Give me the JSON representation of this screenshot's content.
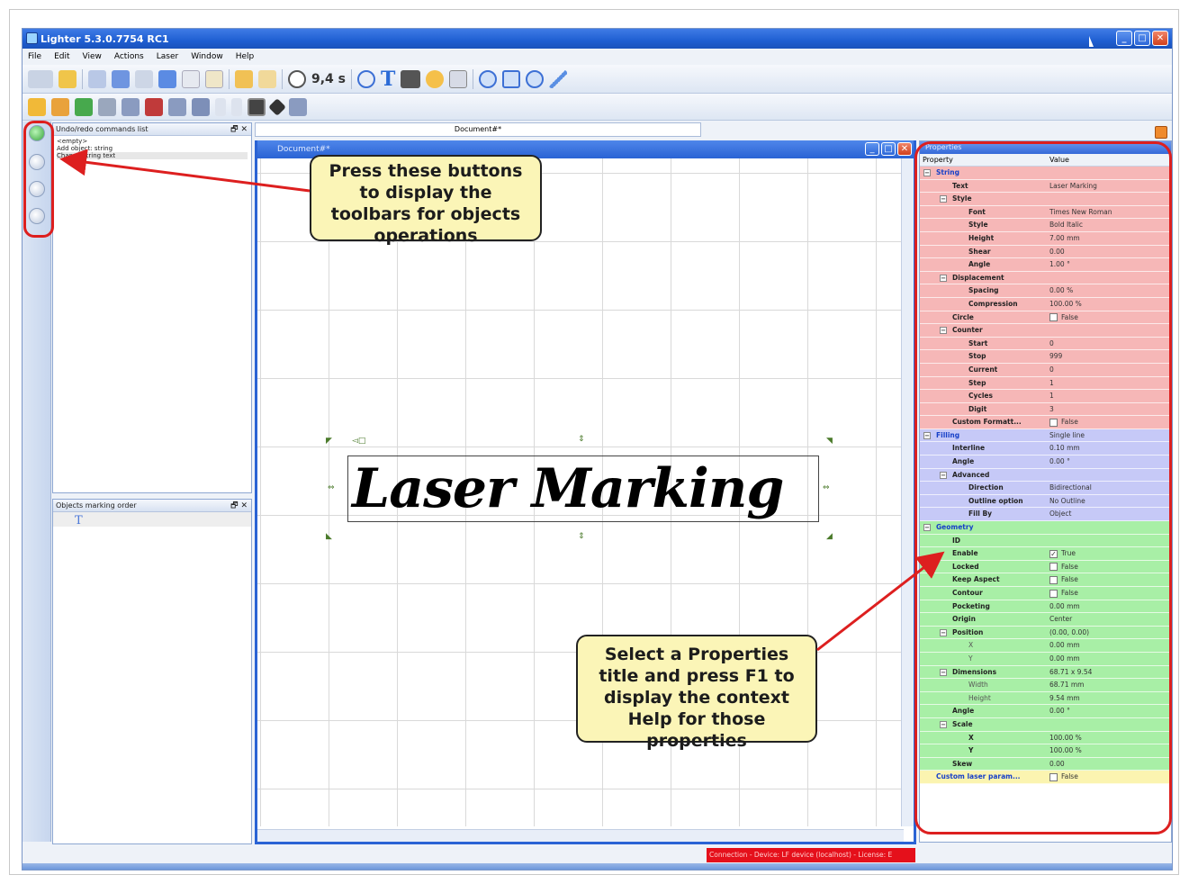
{
  "app": {
    "title": "Lighter 5.3.0.7754 RC1",
    "window_buttons": [
      "_",
      "□",
      "✕"
    ]
  },
  "menu": [
    "File",
    "Edit",
    "View",
    "Actions",
    "Laser",
    "Window",
    "Help"
  ],
  "toolbar": {
    "timer_value": "9,4 s",
    "text_tool_glyph": "T"
  },
  "panels": {
    "undo": {
      "title": "Undo/redo commands list",
      "items": [
        "<empty>",
        "Add object: string",
        "Change string text"
      ]
    },
    "marking_order": {
      "title": "Objects marking order",
      "item_glyph": "T"
    },
    "controls": "🗗 ✕"
  },
  "document": {
    "tab_label": "Document#*",
    "window_title": "Document#*",
    "text": "Laser Marking"
  },
  "properties": {
    "title": "Properties",
    "col_property": "Property",
    "col_value": "Value",
    "rows": [
      {
        "name": "String",
        "value": "",
        "level": 0,
        "expand": "−",
        "cat": true,
        "color": "red"
      },
      {
        "name": "Text",
        "value": "Laser Marking",
        "level": 1,
        "color": "red"
      },
      {
        "name": "Style",
        "value": "",
        "level": 1,
        "expand": "−",
        "color": "red"
      },
      {
        "name": "Font",
        "value": "Times New Roman",
        "level": 2,
        "color": "red"
      },
      {
        "name": "Style",
        "value": "Bold Italic",
        "level": 2,
        "color": "red"
      },
      {
        "name": "Height",
        "value": "7.00 mm",
        "level": 2,
        "color": "red"
      },
      {
        "name": "Shear",
        "value": "0.00",
        "level": 2,
        "color": "red"
      },
      {
        "name": "Angle",
        "value": "1.00 °",
        "level": 2,
        "color": "red"
      },
      {
        "name": "Displacement",
        "value": "",
        "level": 1,
        "expand": "−",
        "color": "red"
      },
      {
        "name": "Spacing",
        "value": "0.00 %",
        "level": 2,
        "color": "red"
      },
      {
        "name": "Compression",
        "value": "100.00 %",
        "level": 2,
        "color": "red"
      },
      {
        "name": "Circle",
        "value": "False",
        "level": 1,
        "check": "",
        "color": "red"
      },
      {
        "name": "Counter",
        "value": "",
        "level": 1,
        "expand": "−",
        "color": "red"
      },
      {
        "name": "Start",
        "value": "0",
        "level": 2,
        "color": "red"
      },
      {
        "name": "Stop",
        "value": "999",
        "level": 2,
        "color": "red"
      },
      {
        "name": "Current",
        "value": "0",
        "level": 2,
        "color": "red"
      },
      {
        "name": "Step",
        "value": "1",
        "level": 2,
        "color": "red"
      },
      {
        "name": "Cycles",
        "value": "1",
        "level": 2,
        "color": "red"
      },
      {
        "name": "Digit",
        "value": "3",
        "level": 2,
        "color": "red"
      },
      {
        "name": "Custom Formatt...",
        "value": "False",
        "level": 1,
        "check": "",
        "color": "red"
      },
      {
        "name": "Filling",
        "value": "Single line",
        "level": 0,
        "expand": "−",
        "cat": true,
        "color": "blue"
      },
      {
        "name": "Interline",
        "value": "0.10 mm",
        "level": 1,
        "color": "blue"
      },
      {
        "name": "Angle",
        "value": "0.00 °",
        "level": 1,
        "color": "blue"
      },
      {
        "name": "Advanced",
        "value": "",
        "level": 1,
        "expand": "−",
        "color": "blue"
      },
      {
        "name": "Direction",
        "value": "Bidirectional",
        "level": 2,
        "color": "blue"
      },
      {
        "name": "Outline option",
        "value": "No Outline",
        "level": 2,
        "color": "blue"
      },
      {
        "name": "Fill By",
        "value": "Object",
        "level": 2,
        "color": "blue"
      },
      {
        "name": "Geometry",
        "value": "",
        "level": 0,
        "expand": "−",
        "cat": true,
        "color": "green"
      },
      {
        "name": "ID",
        "value": "",
        "level": 1,
        "color": "green"
      },
      {
        "name": "Enable",
        "value": "True",
        "level": 1,
        "check": "✓",
        "color": "green"
      },
      {
        "name": "Locked",
        "value": "False",
        "level": 1,
        "check": "",
        "color": "green"
      },
      {
        "name": "Keep Aspect",
        "value": "False",
        "level": 1,
        "check": "",
        "color": "green"
      },
      {
        "name": "Contour",
        "value": "False",
        "level": 1,
        "check": "",
        "color": "green"
      },
      {
        "name": "Pocketing",
        "value": "0.00 mm",
        "level": 1,
        "color": "green"
      },
      {
        "name": "Origin",
        "value": "Center",
        "level": 1,
        "color": "green"
      },
      {
        "name": "Position",
        "value": "(0.00, 0.00)",
        "level": 1,
        "expand": "−",
        "color": "green"
      },
      {
        "name": "X",
        "value": "0.00 mm",
        "level": 2,
        "plain": true,
        "color": "green"
      },
      {
        "name": "Y",
        "value": "0.00 mm",
        "level": 2,
        "plain": true,
        "color": "green"
      },
      {
        "name": "Dimensions",
        "value": "68.71 x 9.54",
        "level": 1,
        "expand": "−",
        "color": "green"
      },
      {
        "name": "Width",
        "value": "68.71 mm",
        "level": 2,
        "plain": true,
        "color": "green"
      },
      {
        "name": "Height",
        "value": "9.54 mm",
        "level": 2,
        "plain": true,
        "color": "green"
      },
      {
        "name": "Angle",
        "value": "0.00 °",
        "level": 1,
        "color": "green"
      },
      {
        "name": "Scale",
        "value": "",
        "level": 1,
        "expand": "−",
        "color": "green"
      },
      {
        "name": "X",
        "value": "100.00 %",
        "level": 2,
        "color": "green"
      },
      {
        "name": "Y",
        "value": "100.00 %",
        "level": 2,
        "color": "green"
      },
      {
        "name": "Skew",
        "value": "0.00",
        "level": 1,
        "color": "green"
      },
      {
        "name": "Custom laser param...",
        "value": "False",
        "level": 0,
        "check": "",
        "cat": true,
        "color": "yellow"
      }
    ]
  },
  "status_bar": "Connection - Device: LF device (localhost) - License: E",
  "callouts": {
    "toolbars": "Press these buttons to display the toolbars for objects operations",
    "properties_help": "Select a Properties title and press F1 to display the context Help for those properties"
  },
  "colors": {
    "annotation_red": "#dd1f1f",
    "callout_fill": "#fbf5b7",
    "string_group": "#f6b7b7",
    "filling_group": "#c6c9f7",
    "geometry_group": "#a8efa6",
    "custom_group": "#fbf4b0",
    "status_red": "#e5101b"
  }
}
